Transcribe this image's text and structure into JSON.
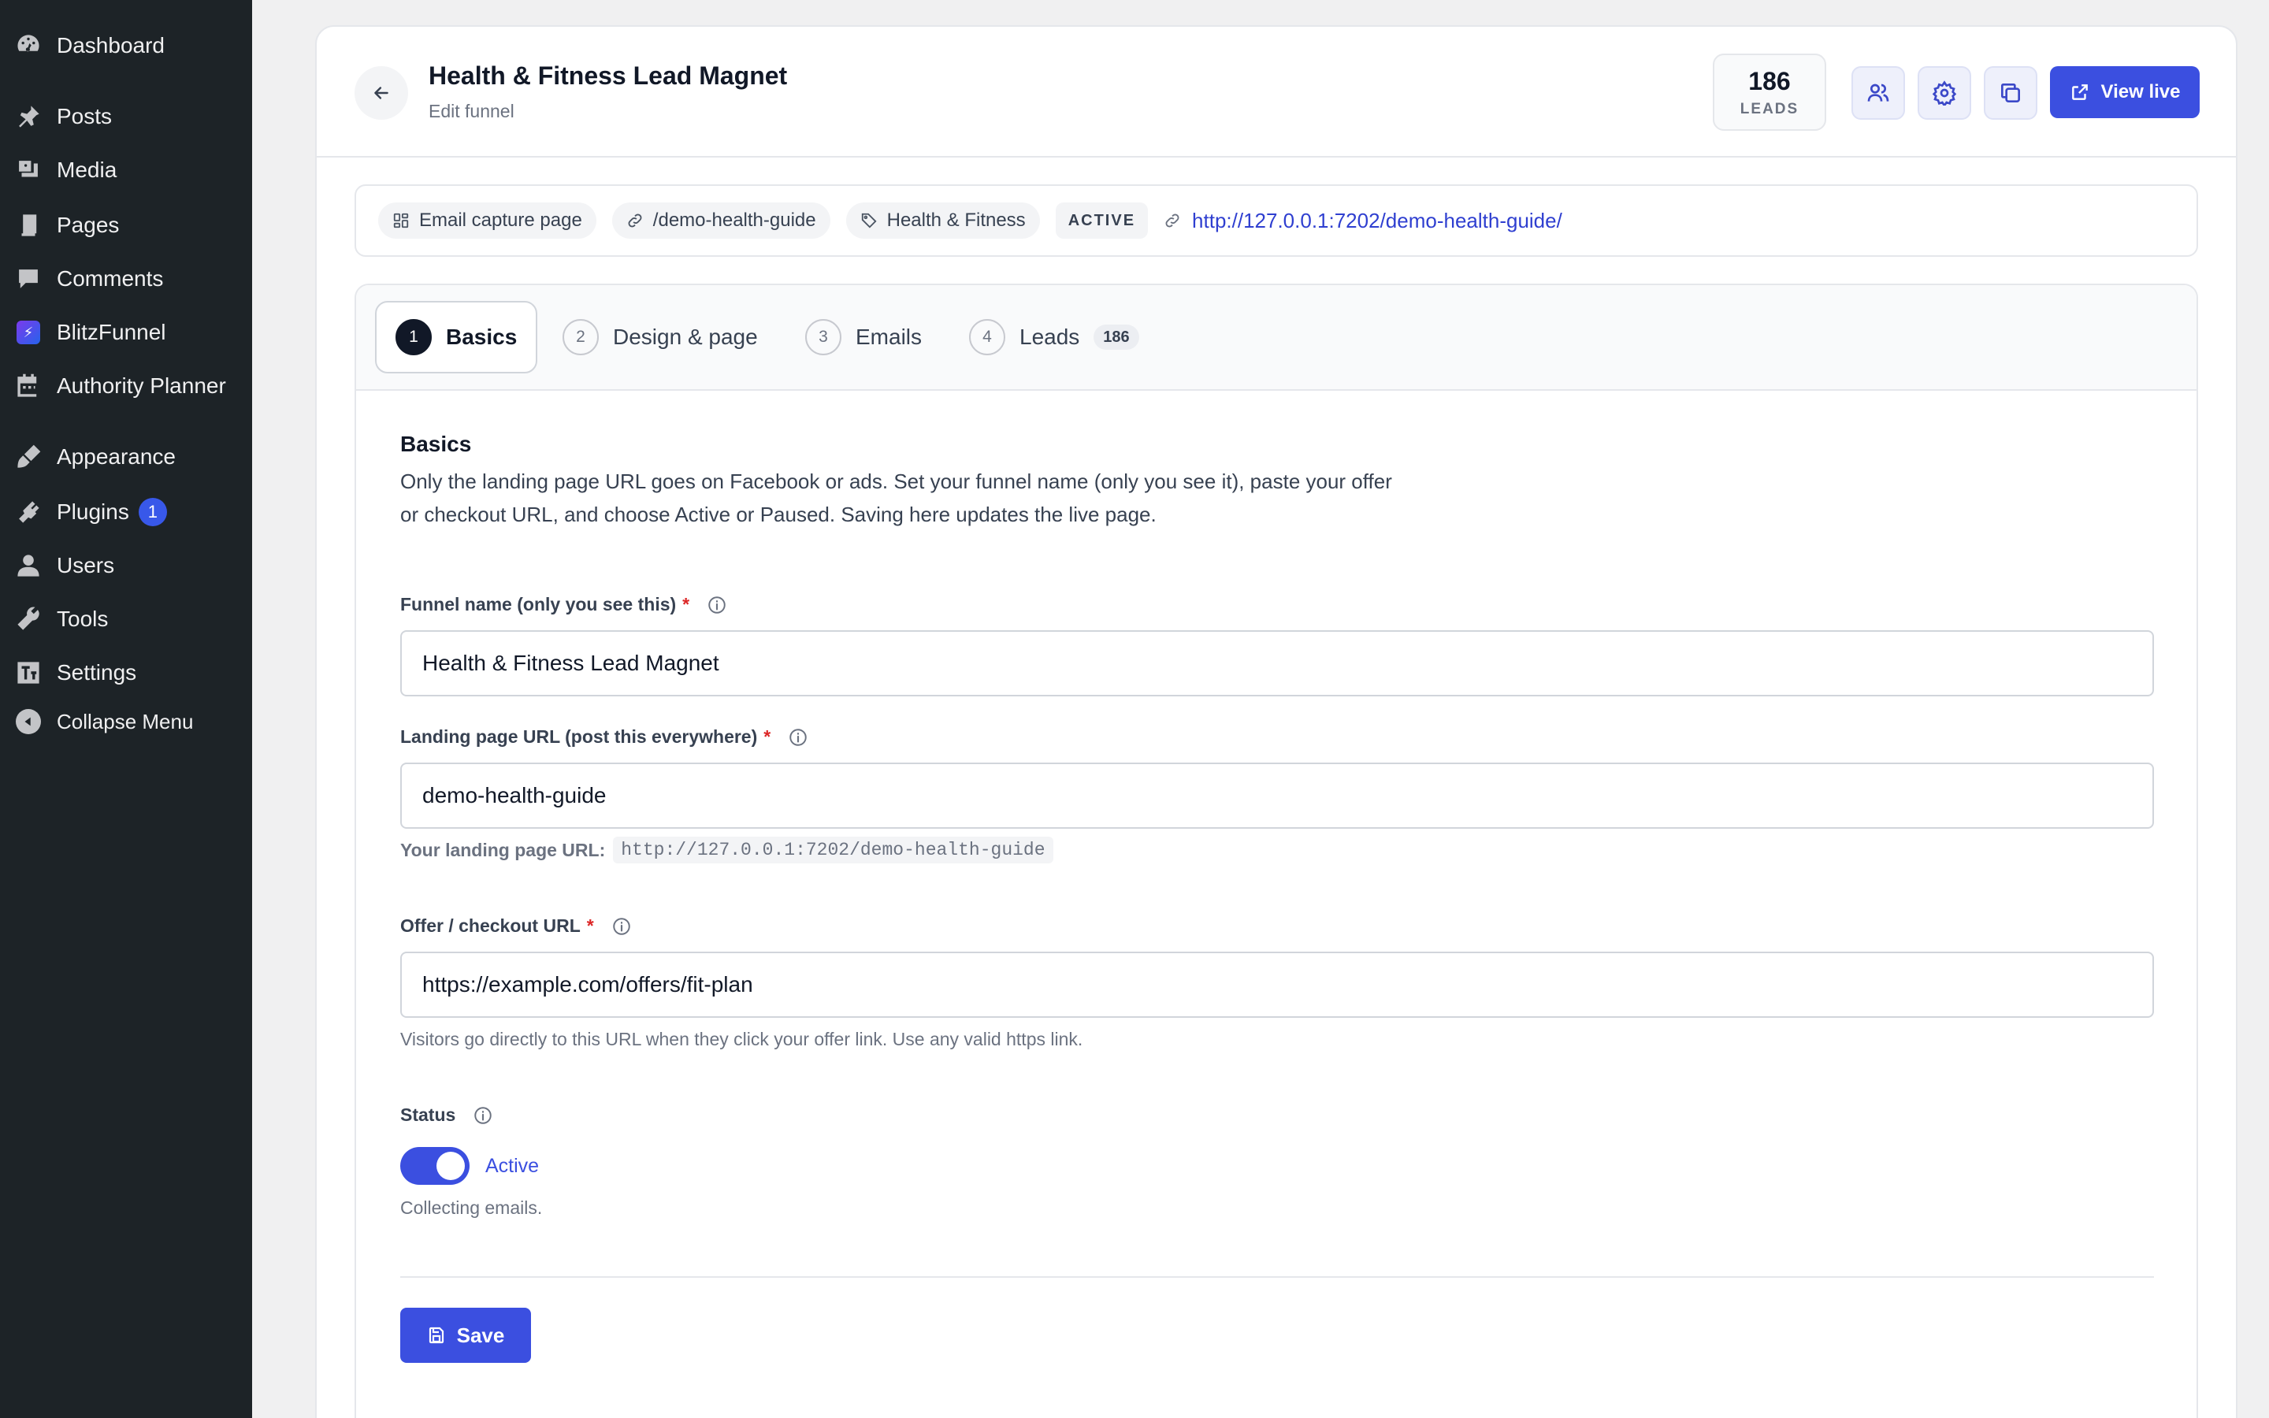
{
  "sidebar": {
    "items": [
      {
        "label": "Dashboard",
        "icon": "dashboard-icon"
      },
      {
        "label": "Posts",
        "icon": "pin-icon"
      },
      {
        "label": "Media",
        "icon": "media-icon"
      },
      {
        "label": "Pages",
        "icon": "pages-icon"
      },
      {
        "label": "Comments",
        "icon": "comment-icon"
      },
      {
        "label": "BlitzFunnel",
        "icon": "blitzfunnel-logo-icon"
      },
      {
        "label": "Authority Planner",
        "icon": "calendar-icon"
      },
      {
        "label": "Appearance",
        "icon": "brush-icon"
      },
      {
        "label": "Plugins",
        "icon": "plugin-icon",
        "badge": "1"
      },
      {
        "label": "Users",
        "icon": "user-icon"
      },
      {
        "label": "Tools",
        "icon": "wrench-icon"
      },
      {
        "label": "Settings",
        "icon": "settings-icon"
      },
      {
        "label": "Collapse Menu",
        "icon": "collapse-icon"
      }
    ]
  },
  "header": {
    "title": "Health & Fitness Lead Magnet",
    "subtitle": "Edit funnel",
    "leads_count": "186",
    "leads_label": "LEADS",
    "view_live_label": "View live"
  },
  "meta": {
    "page_type": "Email capture page",
    "slug": "/demo-health-guide",
    "category": "Health & Fitness",
    "status": "ACTIVE",
    "url": "http://127.0.0.1:7202/demo-health-guide/"
  },
  "tabs": [
    {
      "num": "1",
      "label": "Basics"
    },
    {
      "num": "2",
      "label": "Design & page"
    },
    {
      "num": "3",
      "label": "Emails"
    },
    {
      "num": "4",
      "label": "Leads",
      "badge": "186"
    }
  ],
  "form": {
    "section_title": "Basics",
    "section_desc": "Only the landing page URL goes on Facebook or ads. Set your funnel name (only you see it), paste your offer or checkout URL, and choose Active or Paused. Saving here updates the live page.",
    "funnel_name_label": "Funnel name (only you see this)",
    "funnel_name_value": "Health & Fitness Lead Magnet",
    "landing_url_label": "Landing page URL (post this everywhere)",
    "landing_url_value": "demo-health-guide",
    "landing_url_preview_label": "Your landing page URL:",
    "landing_url_preview": "http://127.0.0.1:7202/demo-health-guide",
    "offer_url_label": "Offer / checkout URL",
    "offer_url_value": "https://example.com/offers/fit-plan",
    "offer_url_hint": "Visitors go directly to this URL when they click your offer link. Use any valid https link.",
    "status_label": "Status",
    "status_value": "Active",
    "status_hint": "Collecting emails.",
    "required_mark": "*",
    "save_label": "Save"
  },
  "colors": {
    "accent": "#3b4fe0",
    "sidebar_bg": "#1d2327",
    "required": "#dc2626"
  }
}
